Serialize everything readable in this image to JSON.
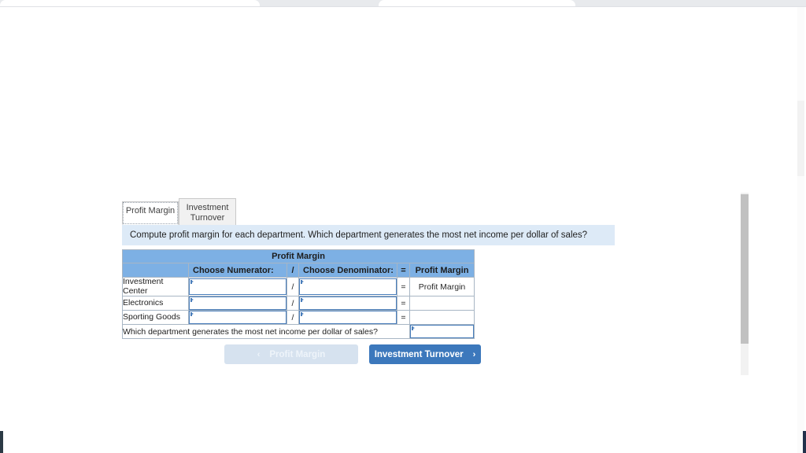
{
  "widget": {
    "tabs": [
      {
        "label": "Profit Margin",
        "active": true
      },
      {
        "label": "Investment Turnover",
        "active": false
      }
    ],
    "instruction": "Compute profit margin for each department. Which department generates the most net income per dollar of sales?",
    "table": {
      "title": "Profit Margin",
      "columns": {
        "department": "",
        "numerator": "Choose Numerator:",
        "divider": "/",
        "denominator": "Choose Denominator:",
        "equals": "=",
        "result": "Profit Margin"
      },
      "rows": [
        {
          "department": "Investment Center",
          "numerator_value": "",
          "divider": "/",
          "denominator_value": "",
          "equals": "=",
          "result": "Profit Margin"
        },
        {
          "department": "Electronics",
          "numerator_value": "",
          "divider": "/",
          "denominator_value": "",
          "equals": "=",
          "result": ""
        },
        {
          "department": "Sporting Goods",
          "numerator_value": "",
          "divider": "/",
          "denominator_value": "",
          "equals": "=",
          "result": ""
        }
      ],
      "footer_question": "Which department generates the most net income per dollar of sales?",
      "footer_answer_value": ""
    },
    "nav": {
      "prev_label": "Profit Margin",
      "prev_chevron": "‹",
      "prev_disabled": true,
      "next_label": "Investment Turnover",
      "next_chevron": "›"
    }
  },
  "colors": {
    "header_blue": "#7db0e4",
    "instruction_blue": "#ddeaf7",
    "button_blue": "#3c78bc",
    "button_disabled": "#d6e2ef",
    "field_border": "#4a7ebb"
  }
}
